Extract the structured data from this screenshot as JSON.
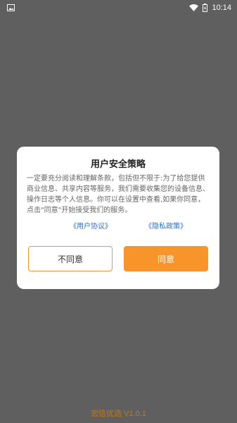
{
  "status_bar": {
    "time": "10:14",
    "icons": [
      "image-icon",
      "wifi-icon",
      "battery-charging-icon"
    ]
  },
  "dialog": {
    "title": "用户安全策略",
    "body": "一定要充分阅读和理解条款，包括但不限于:为了给您提供商业信息、共享内容等服务，我们需要收集您的设备信息、操作日志等个人信息。你可以在设置中查看,如果你同意，点击\"同意\"开始接受我们的服务。",
    "user_agreement_link": "《用户协议》",
    "privacy_policy_link": "《隐私政策》",
    "disagree_label": "不同意",
    "agree_label": "同意"
  },
  "footer": {
    "version": "宏信优选 V1.0.1"
  },
  "colors": {
    "overlay": "#5f5f5f",
    "accent": "#f7952a",
    "link": "#2f6dc1",
    "version_text": "#c2791d"
  }
}
